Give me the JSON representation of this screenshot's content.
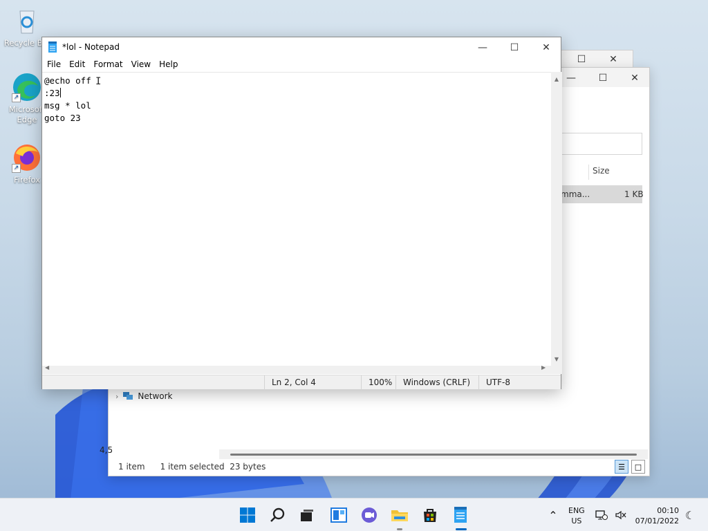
{
  "desktop": {
    "icons": [
      {
        "label": "Recycle Bin"
      },
      {
        "label": "Microsoft Edge"
      },
      {
        "label": "Firefox"
      }
    ]
  },
  "explorer": {
    "column_size": "Size",
    "file_name_partial": "mma...",
    "file_size": "1 KB",
    "nav_network": "Network",
    "status_items": "1 item",
    "status_selected": "1 item selected  23 bytes",
    "clipped_text": "4,5"
  },
  "notepad": {
    "title": "*lol - Notepad",
    "menu": [
      "File",
      "Edit",
      "Format",
      "View",
      "Help"
    ],
    "lines": [
      "@echo off",
      ":23",
      "msg * lol",
      "goto 23"
    ],
    "status": {
      "position": "Ln 2, Col 4",
      "zoom": "100%",
      "line_ending": "Windows (CRLF)",
      "encoding": "UTF-8"
    }
  },
  "taskbar": {
    "apps": [
      "start",
      "search",
      "task-view",
      "widgets",
      "chat",
      "file-explorer",
      "store",
      "notepad"
    ],
    "lang_top": "ENG",
    "lang_bottom": "US",
    "time": "00:10",
    "date": "07/01/2022"
  },
  "colors": {
    "accent": "#0067c0",
    "selection": "#d9d9d9"
  }
}
